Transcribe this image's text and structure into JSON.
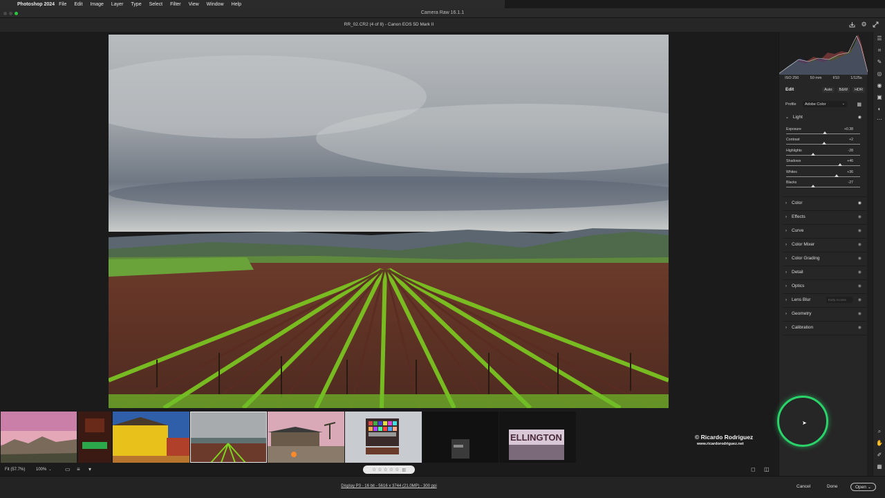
{
  "menubar": {
    "app": "Photoshop 2024",
    "items": [
      "File",
      "Edit",
      "Image",
      "Layer",
      "Type",
      "Select",
      "Filter",
      "View",
      "Window",
      "Help"
    ]
  },
  "window": {
    "title": "Camera Raw 16.1.1"
  },
  "doc": {
    "title": "RR_02.CR2 (4 of 8)  -  Canon EOS 5D Mark II"
  },
  "meta": {
    "iso": "ISO 250",
    "focal": "50 mm",
    "aperture": "f/10",
    "shutter": "1/125s"
  },
  "edit": {
    "label": "Edit",
    "auto": "Auto",
    "bw": "B&W",
    "hdr": "HDR"
  },
  "profile": {
    "label": "Profile",
    "value": "Adobe Color"
  },
  "light": {
    "title": "Light",
    "sliders": [
      {
        "label": "Exposure",
        "value": "+0.38",
        "pos": 0.52
      },
      {
        "label": "Contrast",
        "value": "+2",
        "pos": 0.51
      },
      {
        "label": "Highlights",
        "value": "-28",
        "pos": 0.36
      },
      {
        "label": "Shadows",
        "value": "+46",
        "pos": 0.73
      },
      {
        "label": "Whites",
        "value": "+36",
        "pos": 0.68
      },
      {
        "label": "Blacks",
        "value": "-27",
        "pos": 0.365
      }
    ]
  },
  "sections": [
    "Color",
    "Effects",
    "Curve",
    "Color Mixer",
    "Color Grading",
    "Detail",
    "Optics",
    "Lens Blur",
    "Geometry",
    "Calibration"
  ],
  "lensblur_hint": "Early Access",
  "watermark": {
    "name": "© Ricardo Rodriguez",
    "url": "www.ricardorodriguez.net"
  },
  "bottom": {
    "fit": "Fit (57.7%)",
    "zoom": "100%",
    "info": "Display P3 - 16 bit - 5616 x 3744 (21.0MP) - 300 ppi",
    "cancel": "Cancel",
    "done": "Done",
    "open": "Open"
  },
  "colors": {
    "accent_ring": "#2ad46a",
    "panel": "#262626",
    "canvas": "#1b1b1b"
  }
}
